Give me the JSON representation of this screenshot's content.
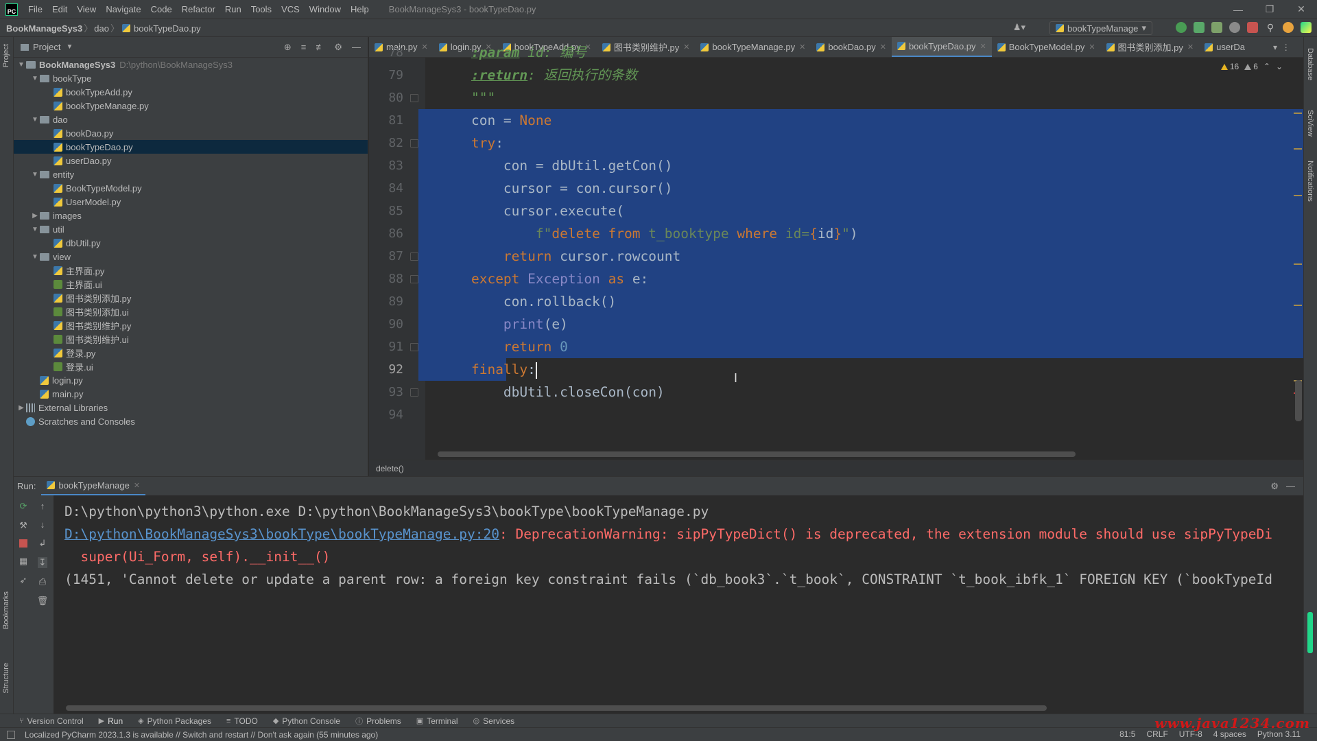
{
  "app": {
    "logo": "PC",
    "window_title": "BookManageSys3 - bookTypeDao.py",
    "menu": [
      "File",
      "Edit",
      "View",
      "Navigate",
      "Code",
      "Refactor",
      "Run",
      "Tools",
      "VCS",
      "Window",
      "Help"
    ]
  },
  "breadcrumb": {
    "project": "BookManageSys3",
    "folder": "dao",
    "file": "bookTypeDao.py"
  },
  "run_config": {
    "label": "bookTypeManage"
  },
  "project_panel": {
    "title": "Project",
    "root": {
      "name": "BookManageSys3",
      "path": "D:\\python\\BookManageSys3"
    },
    "items": [
      {
        "label": "bookType",
        "kind": "folder",
        "indent": 1,
        "expanded": true
      },
      {
        "label": "bookTypeAdd.py",
        "kind": "py",
        "indent": 2
      },
      {
        "label": "bookTypeManage.py",
        "kind": "py",
        "indent": 2
      },
      {
        "label": "dao",
        "kind": "folder",
        "indent": 1,
        "expanded": true
      },
      {
        "label": "bookDao.py",
        "kind": "py",
        "indent": 2
      },
      {
        "label": "bookTypeDao.py",
        "kind": "py",
        "indent": 2,
        "selected": true
      },
      {
        "label": "userDao.py",
        "kind": "py",
        "indent": 2
      },
      {
        "label": "entity",
        "kind": "folder",
        "indent": 1,
        "expanded": true
      },
      {
        "label": "BookTypeModel.py",
        "kind": "py",
        "indent": 2
      },
      {
        "label": "UserModel.py",
        "kind": "py",
        "indent": 2
      },
      {
        "label": "images",
        "kind": "folder",
        "indent": 1,
        "expanded": false
      },
      {
        "label": "util",
        "kind": "folder",
        "indent": 1,
        "expanded": true
      },
      {
        "label": "dbUtil.py",
        "kind": "py",
        "indent": 2
      },
      {
        "label": "view",
        "kind": "folder",
        "indent": 1,
        "expanded": true
      },
      {
        "label": "主界面.py",
        "kind": "py",
        "indent": 2
      },
      {
        "label": "主界面.ui",
        "kind": "ui",
        "indent": 2
      },
      {
        "label": "图书类别添加.py",
        "kind": "py",
        "indent": 2
      },
      {
        "label": "图书类别添加.ui",
        "kind": "ui",
        "indent": 2
      },
      {
        "label": "图书类别维护.py",
        "kind": "py",
        "indent": 2
      },
      {
        "label": "图书类别维护.ui",
        "kind": "ui",
        "indent": 2
      },
      {
        "label": "登录.py",
        "kind": "py",
        "indent": 2
      },
      {
        "label": "登录.ui",
        "kind": "ui",
        "indent": 2
      },
      {
        "label": "login.py",
        "kind": "py",
        "indent": 1
      },
      {
        "label": "main.py",
        "kind": "py",
        "indent": 1
      },
      {
        "label": "External Libraries",
        "kind": "lib",
        "indent": 0,
        "expanded": false
      },
      {
        "label": "Scratches and Consoles",
        "kind": "scratch",
        "indent": 0
      }
    ]
  },
  "tabs": [
    {
      "label": "main.py"
    },
    {
      "label": "login.py"
    },
    {
      "label": "bookTypeAdd.py"
    },
    {
      "label": "图书类别维护.py"
    },
    {
      "label": "bookTypeManage.py"
    },
    {
      "label": "bookDao.py"
    },
    {
      "label": "bookTypeDao.py",
      "active": true
    },
    {
      "label": "BookTypeModel.py"
    },
    {
      "label": "图书类别添加.py"
    },
    {
      "label": "userDa"
    }
  ],
  "editor": {
    "warnings": "16",
    "weak_warnings": "6",
    "current_line": 92,
    "lines": [
      {
        "n": 78,
        "tokens": [
          {
            "t": "    "
          },
          {
            "t": ":param",
            "c": "doctag"
          },
          {
            "t": " id: ",
            "c": "doc"
          },
          {
            "t": "编号",
            "c": "doc"
          }
        ]
      },
      {
        "n": 79,
        "tokens": [
          {
            "t": "    "
          },
          {
            "t": ":return",
            "c": "doctag"
          },
          {
            "t": ": 返回执行的条数",
            "c": "doc"
          }
        ]
      },
      {
        "n": 80,
        "tokens": [
          {
            "t": "    "
          },
          {
            "t": "\"\"\"",
            "c": "doc"
          }
        ]
      },
      {
        "n": 81,
        "sel": true,
        "tokens": [
          {
            "t": "    con = "
          },
          {
            "t": "None",
            "c": "kw"
          }
        ]
      },
      {
        "n": 82,
        "sel": true,
        "tokens": [
          {
            "t": "    "
          },
          {
            "t": "try",
            "c": "kw"
          },
          {
            "t": ":"
          }
        ]
      },
      {
        "n": 83,
        "sel": true,
        "tokens": [
          {
            "t": "        con = dbUtil.getCon()"
          }
        ]
      },
      {
        "n": 84,
        "sel": true,
        "tokens": [
          {
            "t": "        cursor = con.cursor()"
          }
        ]
      },
      {
        "n": 85,
        "sel": true,
        "tokens": [
          {
            "t": "        cursor.execute("
          }
        ]
      },
      {
        "n": 86,
        "sel": true,
        "tokens": [
          {
            "t": "            "
          },
          {
            "t": "f\"",
            "c": "str"
          },
          {
            "t": "delete from",
            "c": "kw"
          },
          {
            "t": " t_booktype ",
            "c": "str"
          },
          {
            "t": "where",
            "c": "kw"
          },
          {
            "t": " id=",
            "c": "str"
          },
          {
            "t": "{",
            "c": "kw"
          },
          {
            "t": "id"
          },
          {
            "t": "}",
            "c": "kw"
          },
          {
            "t": "\"",
            "c": "str"
          },
          {
            "t": ")"
          }
        ]
      },
      {
        "n": 87,
        "sel": true,
        "tokens": [
          {
            "t": "        "
          },
          {
            "t": "return",
            "c": "kw"
          },
          {
            "t": " cursor.rowcount"
          }
        ]
      },
      {
        "n": 88,
        "sel": true,
        "tokens": [
          {
            "t": "    "
          },
          {
            "t": "except",
            "c": "kw"
          },
          {
            "t": " "
          },
          {
            "t": "Exception",
            "c": "bi"
          },
          {
            "t": " "
          },
          {
            "t": "as",
            "c": "kw"
          },
          {
            "t": " e:"
          }
        ]
      },
      {
        "n": 89,
        "sel": true,
        "tokens": [
          {
            "t": "        con.rollback()"
          }
        ]
      },
      {
        "n": 90,
        "sel": true,
        "tokens": [
          {
            "t": "        "
          },
          {
            "t": "print",
            "c": "bi"
          },
          {
            "t": "(e)"
          }
        ]
      },
      {
        "n": 91,
        "sel": true,
        "tokens": [
          {
            "t": "        "
          },
          {
            "t": "return",
            "c": "kw"
          },
          {
            "t": " "
          },
          {
            "t": "0",
            "c": "num"
          }
        ]
      },
      {
        "n": 92,
        "sel": true,
        "partial": true,
        "tokens": [
          {
            "t": "    "
          },
          {
            "t": "finally",
            "c": "kw"
          },
          {
            "t": ":"
          }
        ]
      },
      {
        "n": 93,
        "tokens": [
          {
            "t": "        dbUtil.closeCon(con)"
          }
        ]
      },
      {
        "n": 94,
        "tokens": [
          {
            "t": ""
          }
        ]
      }
    ],
    "breadcrumb_func": "delete()"
  },
  "run_panel": {
    "label": "Run:",
    "tab": "bookTypeManage",
    "lines": [
      {
        "kind": "stdout",
        "text": "D:\\python\\python3\\python.exe D:\\python\\BookManageSys3\\bookType\\bookTypeManage.py"
      },
      {
        "kind": "err",
        "link": "D:\\python\\BookManageSys3\\bookType\\bookTypeManage.py:20",
        "text": ": DeprecationWarning: sipPyTypeDict() is deprecated, the extension module should use sipPyTypeDi"
      },
      {
        "kind": "err",
        "text": "  super(Ui_Form, self).__init__()"
      },
      {
        "kind": "stdout",
        "text": "(1451, 'Cannot delete or update a parent row: a foreign key constraint fails (`db_book3`.`t_book`, CONSTRAINT `t_book_ibfk_1` FOREIGN KEY (`bookTypeId"
      }
    ]
  },
  "bottom_tools": [
    "Version Control",
    "Run",
    "Python Packages",
    "TODO",
    "Python Console",
    "Problems",
    "Terminal",
    "Services"
  ],
  "left_strip": [
    "Project",
    "Bookmarks",
    "Structure"
  ],
  "right_strip": [
    "Database",
    "SciView",
    "Notifications"
  ],
  "status": {
    "message": "Localized PyCharm 2023.1.3 is available // Switch and restart // Don't ask again (55 minutes ago)",
    "position": "81:5",
    "line_sep": "CRLF",
    "encoding": "UTF-8",
    "indent": "4 spaces",
    "interpreter": "Python 3.11"
  },
  "watermark": "www.java1234.com"
}
